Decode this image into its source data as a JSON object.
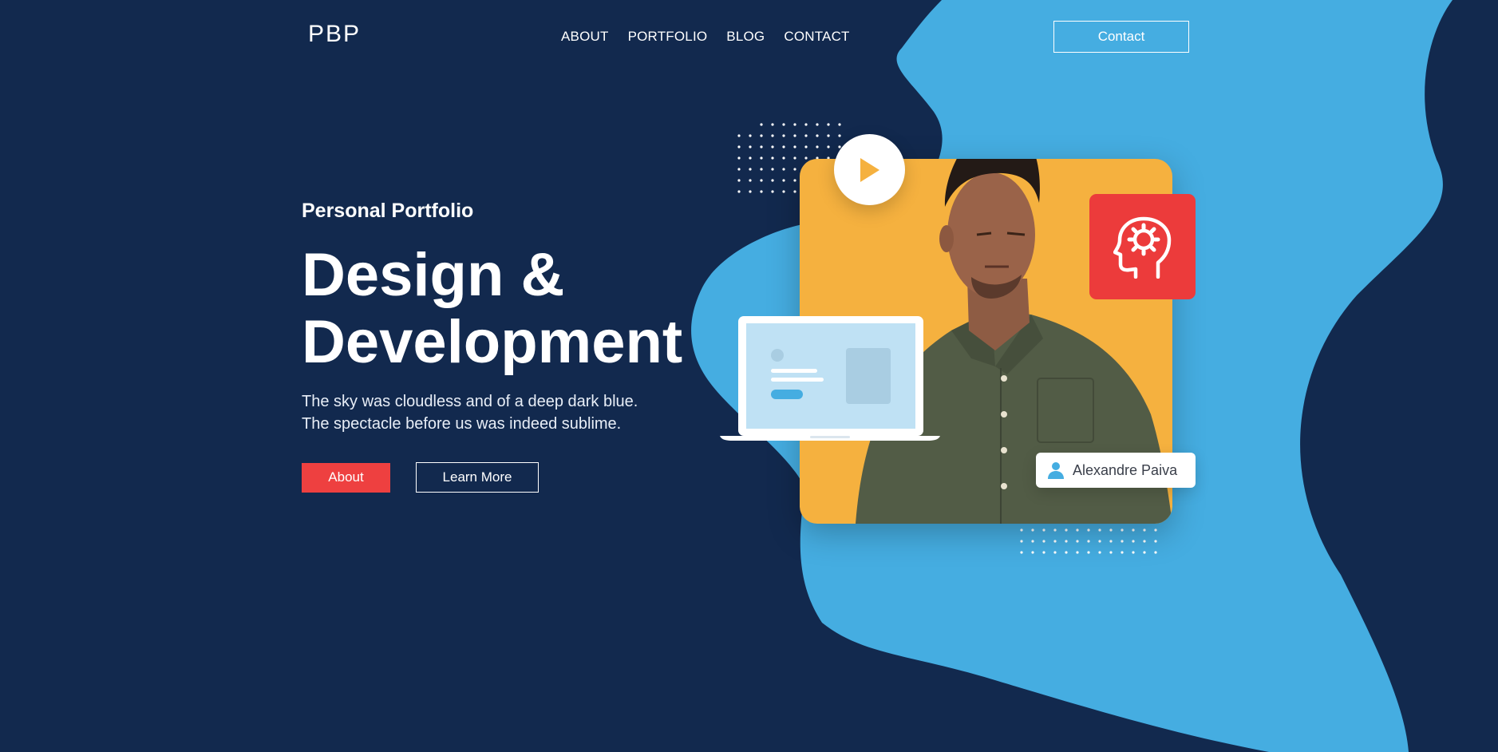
{
  "brand": {
    "logo": "PBP"
  },
  "nav": {
    "links": [
      "ABOUT",
      "PORTFOLIO",
      "BLOG",
      "CONTACT"
    ],
    "contact_button": "Contact"
  },
  "hero": {
    "eyebrow": "Personal Portfolio",
    "headline_line1": "Design &",
    "headline_line2": "Development",
    "lead_line1": "The sky was cloudless and of a deep dark blue.",
    "lead_line2": "The spectacle before us was indeed sublime.",
    "primary_button": "About",
    "secondary_button": "Learn More"
  },
  "profile": {
    "name": "Alexandre Paiva"
  },
  "icons": {
    "play": "play-icon",
    "brain": "brain-gear-icon",
    "user": "user-icon",
    "laptop": "laptop-icon"
  },
  "colors": {
    "background": "#12294e",
    "blob": "#45ade1",
    "card": "#f5b13f",
    "accent_red": "#ec3b3b",
    "button_red": "#ee4040"
  }
}
